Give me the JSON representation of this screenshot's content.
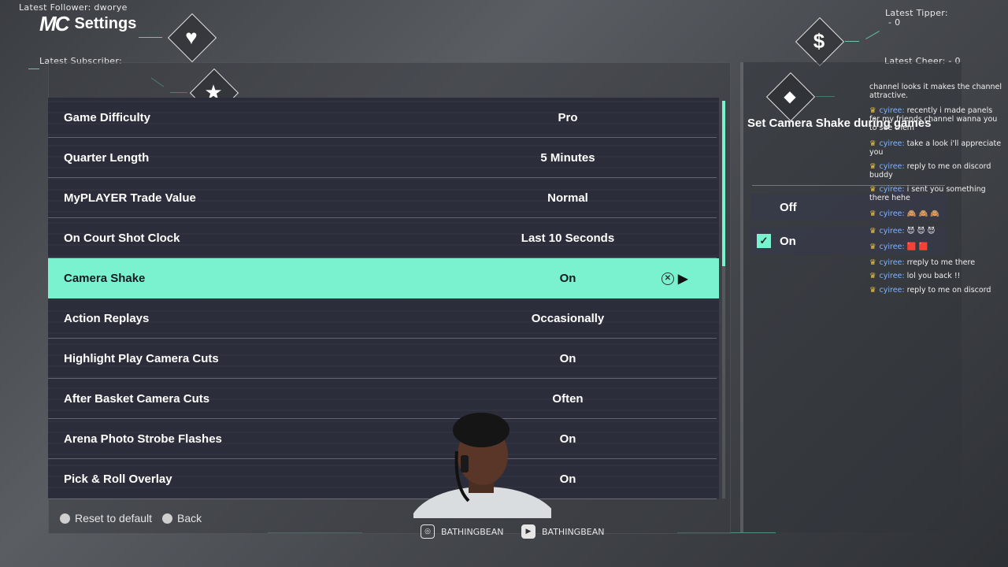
{
  "overlay": {
    "latest_follower": "Latest Follower: dworye",
    "latest_subscriber": "Latest Subscriber:",
    "latest_tipper": "Latest Tipper:",
    "tipper_value": "- 0",
    "latest_cheer": "Latest Cheer: - 0",
    "accent_color": "#7af2cf"
  },
  "header": {
    "logo": "MC",
    "title": "Settings"
  },
  "settings": [
    {
      "label": "Game Difficulty",
      "value": "Pro"
    },
    {
      "label": "Quarter Length",
      "value": "5 Minutes"
    },
    {
      "label": "MyPLAYER Trade Value",
      "value": "Normal"
    },
    {
      "label": "On Court Shot Clock",
      "value": "Last 10 Seconds"
    },
    {
      "label": "Camera Shake",
      "value": "On",
      "selected": true
    },
    {
      "label": "Action Replays",
      "value": "Occasionally"
    },
    {
      "label": "Highlight Play Camera Cuts",
      "value": "On"
    },
    {
      "label": "After Basket Camera Cuts",
      "value": "Often"
    },
    {
      "label": "Arena Photo Strobe Flashes",
      "value": "On"
    },
    {
      "label": "Pick & Roll Overlay",
      "value": "On"
    }
  ],
  "footer": {
    "reset_label": "Reset to default",
    "back_label": "Back"
  },
  "info": {
    "title": "Set Camera Shake during games",
    "options": [
      {
        "label": "Off",
        "checked": false
      },
      {
        "label": "On",
        "checked": true
      }
    ]
  },
  "chat": [
    {
      "user": "",
      "text": "channel looks it makes the channel attractive."
    },
    {
      "user": "cyiree:",
      "text": "recently i made panels for my friends channel wanna you to see them"
    },
    {
      "user": "cyiree:",
      "text": "take a look i'll appreciate you"
    },
    {
      "user": "cyiree:",
      "text": "reply to me on discord buddy"
    },
    {
      "user": "cyiree:",
      "text": "i sent you something there hehe"
    },
    {
      "user": "cyiree:",
      "text": ""
    },
    {
      "user": "cyiree:",
      "text": ""
    },
    {
      "user": "cyiree:",
      "text": ""
    },
    {
      "user": "cyiree:",
      "text": "rreply to me there"
    },
    {
      "user": "cyiree:",
      "text": "lol you back !!"
    },
    {
      "user": "cyiree:",
      "text": "reply to me on discord"
    }
  ],
  "socials": [
    {
      "icon": "instagram-icon",
      "handle": "BATHINGBEAN"
    },
    {
      "icon": "youtube-icon",
      "handle": "BATHINGBEAN"
    }
  ]
}
